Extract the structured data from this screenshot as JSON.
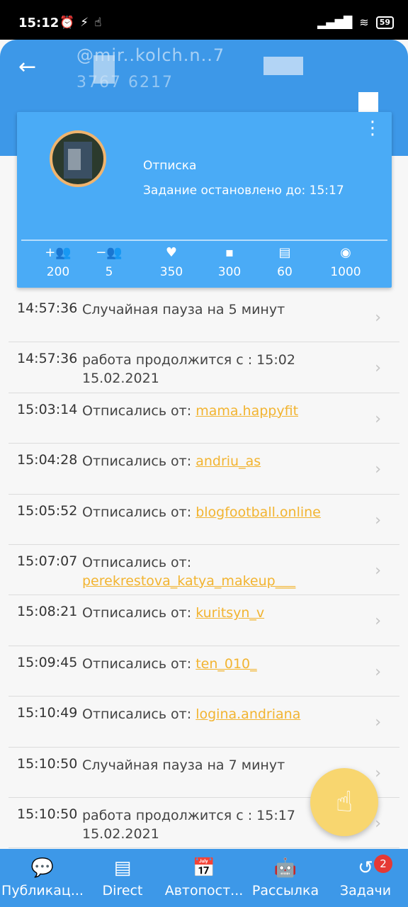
{
  "status_bar": {
    "time": "15:12",
    "battery": "59"
  },
  "header": {
    "handle": "@mir..kolch.n..7",
    "id": "3767 6217",
    "back_icon": "arrow-left-icon"
  },
  "card": {
    "title": "Отписка",
    "subtitle": "Задание остановлено до: 15:17",
    "stats": [
      {
        "icon": "add-user-icon",
        "value": "200"
      },
      {
        "icon": "remove-user-icon",
        "value": "5"
      },
      {
        "icon": "heart-icon",
        "value": "350"
      },
      {
        "icon": "comment-icon",
        "value": "300"
      },
      {
        "icon": "message-icon",
        "value": "60"
      },
      {
        "icon": "profile-icon",
        "value": "1000"
      }
    ]
  },
  "log": [
    {
      "time": "14:57:36",
      "text": "Случайная пауза на 5 минут",
      "link": ""
    },
    {
      "time": "14:57:36",
      "text": "работа продолжится с : 15:02 15.02.2021",
      "link": ""
    },
    {
      "time": "15:03:14",
      "text": "Отписались от: ",
      "link": "mama.happyfit"
    },
    {
      "time": "15:04:28",
      "text": "Отписались от: ",
      "link": "andriu_as"
    },
    {
      "time": "15:05:52",
      "text": "Отписались от: ",
      "link": "blogfootball.online"
    },
    {
      "time": "15:07:07",
      "text": "Отписались от: ",
      "link": "perekrestova_katya_makeup___"
    },
    {
      "time": "15:08:21",
      "text": "Отписались от: ",
      "link": "kuritsyn_v"
    },
    {
      "time": "15:09:45",
      "text": "Отписались от: ",
      "link": "ten_010_"
    },
    {
      "time": "15:10:49",
      "text": "Отписались от: ",
      "link": "logina.andriana"
    },
    {
      "time": "15:10:50",
      "text": "Случайная пауза на 7 минут",
      "link": ""
    },
    {
      "time": "15:10:50",
      "text": "работа продолжится с : 15:17 15.02.2021",
      "link": ""
    }
  ],
  "bottom_nav": [
    {
      "label": "Публикац...",
      "icon": "chat-bubble-icon"
    },
    {
      "label": "Direct",
      "icon": "message-icon"
    },
    {
      "label": "Автопост...",
      "icon": "calendar-icon"
    },
    {
      "label": "Рассылка",
      "icon": "android-icon"
    },
    {
      "label": "Задачи",
      "icon": "history-icon"
    }
  ],
  "tasks_badge": "2",
  "colors": {
    "primary": "#3d98e8",
    "card": "#4aabf6",
    "link": "#f2b431",
    "fab": "#f8d66f",
    "badge": "#e53935"
  }
}
